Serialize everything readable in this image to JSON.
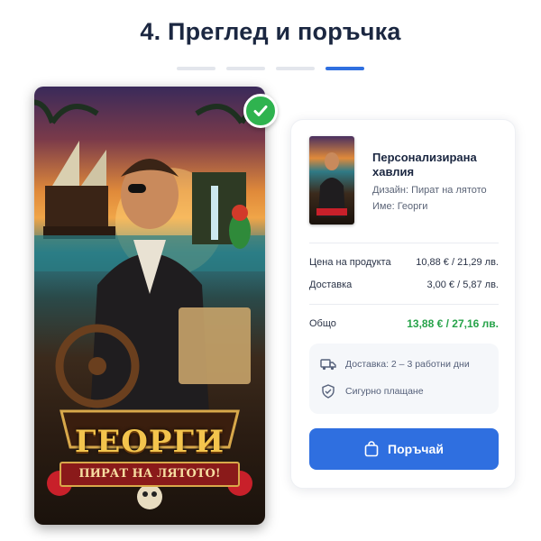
{
  "header": {
    "title": "4. Преглед и поръчка",
    "steps": [
      false,
      false,
      false,
      true
    ]
  },
  "preview": {
    "name_text": "ГЕОРГИ",
    "ribbon_text": "ПИРАТ НА ЛЯТОТО!",
    "badge_icon": "check-icon"
  },
  "order": {
    "product_title": "Персонализирана хавлия",
    "design_line": "Дизайн: Пират на лятото",
    "name_line": "Име: Георги",
    "price_label": "Цена на продукта",
    "price_value": "10,88 € / 21,29 лв.",
    "shipping_label": "Доставка",
    "shipping_value": "3,00 € / 5,87 лв.",
    "total_label": "Общо",
    "total_value": "13,88 € / 27,16 лв.",
    "delivery_info": "Доставка: 2 – 3 работни дни",
    "secure_info": "Сигурно плащане",
    "order_button": "Поръчай"
  },
  "colors": {
    "accent": "#2f6fe0",
    "success": "#27a34a",
    "title": "#1b2741"
  }
}
